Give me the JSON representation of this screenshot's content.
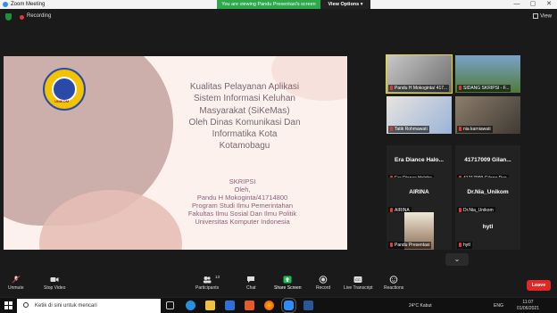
{
  "window": {
    "title": "Zoom Meeting",
    "controls": [
      "—",
      "▢",
      "✕"
    ]
  },
  "share_banner": {
    "text": "You are viewing Pandu Presentasi's screen",
    "view_options": "View Options ▾"
  },
  "topbar": {
    "recording": "Recording",
    "view": "View"
  },
  "slide": {
    "logo_text": "UNIKOM",
    "title_lines": [
      "Kualitas Pelayanan Aplikasi",
      "Sistem Informasi Keluhan",
      "Masyarakat (SiKeMas)",
      "Oleh Dinas Komunikasi Dan",
      "Informatika Kota",
      "Kotamobagu"
    ],
    "subtitle_lines": [
      "SKRIPSI",
      "Oleh,",
      "Pandu H Mokoginta/41714800",
      "Program Studi Ilmu Pemerintahan",
      "Fakultas Ilmu Sosial Dan Ilmu Politik",
      "Universitas Komputer Indonesia"
    ]
  },
  "participants": [
    {
      "label": "Pandu H Mokoginta/ 417...",
      "center": "",
      "video": true
    },
    {
      "label": "SIDANG SKRIPSI - F...",
      "center": "",
      "video": true
    },
    {
      "label": "Tatik Rohmawati",
      "center": "",
      "video": true
    },
    {
      "label": "nia karniawati",
      "center": "",
      "video": true
    },
    {
      "label": "Era Diance Haloho",
      "center": "Era Diance Halo...",
      "video": false
    },
    {
      "label": "41717009 Gilang Deo",
      "center": "41717009 Gilan...",
      "video": false
    },
    {
      "label": "AIRINA",
      "center": "AIRINA",
      "video": false
    },
    {
      "label": "Dr.Nia_Unikom",
      "center": "Dr.Nia_Unikom",
      "video": false
    },
    {
      "label": "Pandu Presentasi",
      "center": "",
      "video": true
    },
    {
      "label": "hytl",
      "center": "hytl",
      "video": false
    }
  ],
  "toolbar": {
    "unmute": "Unmute",
    "stop_video": "Stop Video",
    "participants": "Participants",
    "participants_count": "13",
    "chat": "Chat",
    "share_screen": "Share Screen",
    "record": "Record",
    "live_transcript": "Live Transcript",
    "reactions": "Reactions",
    "leave": "Leave"
  },
  "taskbar": {
    "search_placeholder": "Ketik di sini untuk mencari",
    "weather": "24°C  Kabut",
    "lang": "ENG",
    "time": "11:07",
    "date": "01/06/2021"
  }
}
